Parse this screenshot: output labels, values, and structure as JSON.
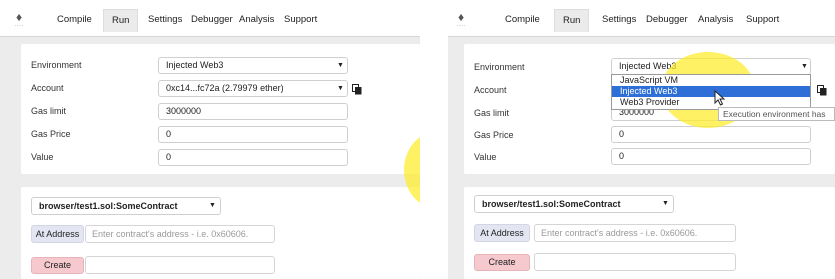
{
  "nav": {
    "tabs": [
      "Compile",
      "Run",
      "Settings",
      "Debugger",
      "Analysis",
      "Support"
    ],
    "active": "Run"
  },
  "labels": {
    "environment": "Environment",
    "account": "Account",
    "gas_limit": "Gas limit",
    "gas_price": "Gas Price",
    "value": "Value"
  },
  "left": {
    "environment": "Injected Web3",
    "account": "0xc14...fc72a (2.79979 ether)",
    "gas_limit": "3000000",
    "gas_price": "0",
    "value": "0"
  },
  "right": {
    "environment": "Injected Web3",
    "gas_limit_partial": "3000000",
    "gas_price": "0",
    "value": "0",
    "dropdown_options": [
      "JavaScript VM",
      "Injected Web3",
      "Web3 Provider"
    ],
    "dropdown_selected_index": 1,
    "tooltip": "Execution environment has"
  },
  "contract": {
    "selected": "browser/test1.sol:SomeContract",
    "at_address_label": "At Address",
    "address_placeholder": "Enter contract's address - i.e. 0x60606.",
    "create_label": "Create"
  },
  "colors": {
    "create_button": "#f5c9cd",
    "at_address_button": "#e3e6f2",
    "highlight": "#ffec28",
    "dropdown_selected": "#2d6fd6"
  }
}
